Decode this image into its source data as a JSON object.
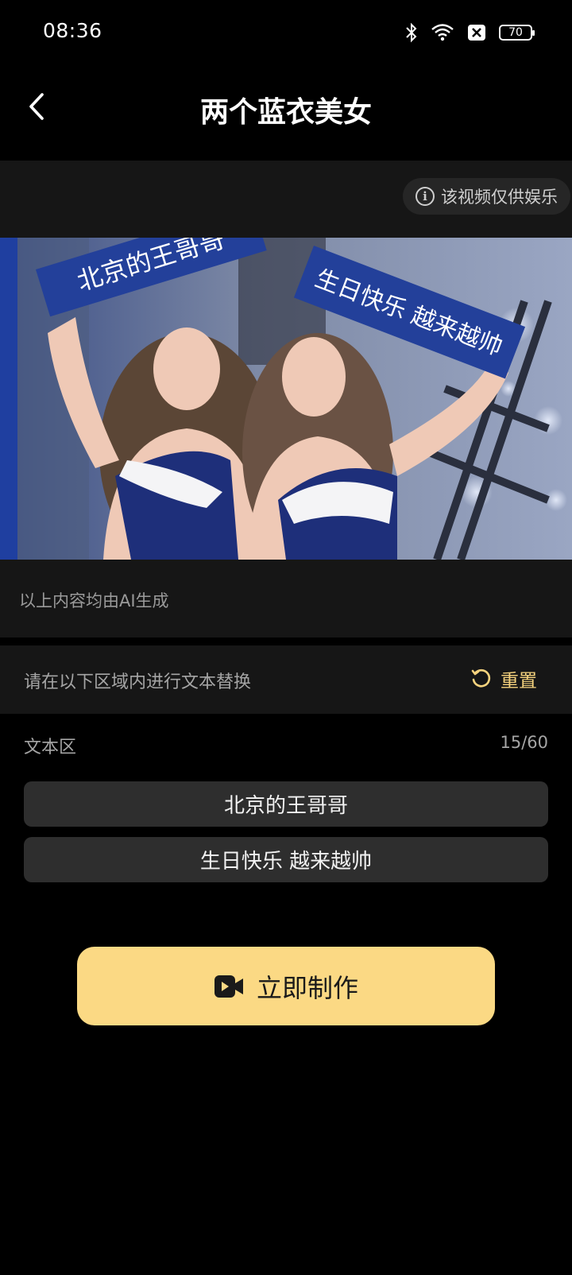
{
  "status_bar": {
    "time": "08:36",
    "battery": "70"
  },
  "nav": {
    "title": "两个蓝衣美女"
  },
  "preview": {
    "disclaimer": "该视频仅供娱乐",
    "sign_left": "北京的王哥哥",
    "sign_right": "生日快乐 越来越帅",
    "ai_note": "以上内容均由AI生成"
  },
  "editor": {
    "replace_hint": "请在以下区域内进行文本替换",
    "reset_label": "重置",
    "text_area_label": "文本区",
    "char_count": "15/60",
    "fields": [
      {
        "value": "北京的王哥哥"
      },
      {
        "value": "生日快乐 越来越帅"
      }
    ]
  },
  "actions": {
    "make_label": "立即制作"
  },
  "colors": {
    "accent": "#fbd984",
    "reset_text": "#f6d37e",
    "sign_blue": "#23409a"
  }
}
